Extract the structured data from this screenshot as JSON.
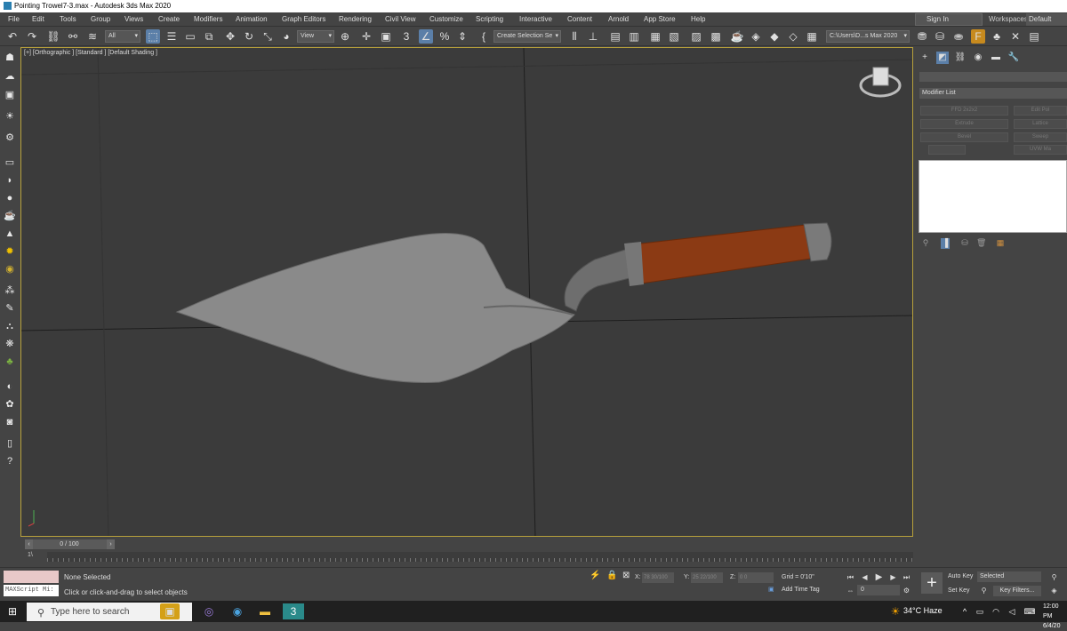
{
  "window": {
    "title": "Pointing Trowel7-3.max - Autodesk 3ds Max 2020"
  },
  "menu": [
    "File",
    "Edit",
    "Tools",
    "Group",
    "Views",
    "Create",
    "Modifiers",
    "Animation",
    "Graph Editors",
    "Rendering",
    "Civil View",
    "Customize",
    "Scripting",
    "Interactive",
    "Content",
    "Arnold",
    "App Store",
    "Help"
  ],
  "account": {
    "signin": "Sign In",
    "workspaces_label": "Workspaces:",
    "workspace": "Default"
  },
  "toolbar": {
    "filter": "All",
    "refcoord": "View",
    "named_selection": "Create Selection Se",
    "project_path": "C:\\Users\\D...s Max 2020",
    "snap_count": "3"
  },
  "viewport": {
    "label": "[+] [Orthographic ] [Standard ] [Default Shading ]"
  },
  "command_panel": {
    "modifier_list": "Modifier List",
    "modifier_buttons": [
      "FFD 2x2x2",
      "Edit Pol",
      "Extrude",
      "Lattice",
      "Bevel",
      "Sweep",
      "",
      "UVW Ma"
    ]
  },
  "timeline": {
    "frame": "0 / 100",
    "scale_label": "1\\"
  },
  "status": {
    "maxscript": "MAXScript Mi:",
    "selection": "None Selected",
    "prompt": "Click or click-and-drag to select objects",
    "x_label": "X:",
    "x_value": "78 30/100",
    "y_label": "Y:",
    "y_value": "25 22/100",
    "z_label": "Z:",
    "z_value": "0 0",
    "grid": "Grid = 0'10\"",
    "add_time_tag": "Add Time Tag",
    "frame_field": "0",
    "auto_key": "Auto Key",
    "set_key": "Set Key",
    "key_mode": "Selected",
    "key_filters": "Key Filters..."
  },
  "taskbar": {
    "search_placeholder": "Type here to search",
    "temperature": "34°C  Haze",
    "time": "12:00 PM",
    "date": "6/4/20"
  }
}
